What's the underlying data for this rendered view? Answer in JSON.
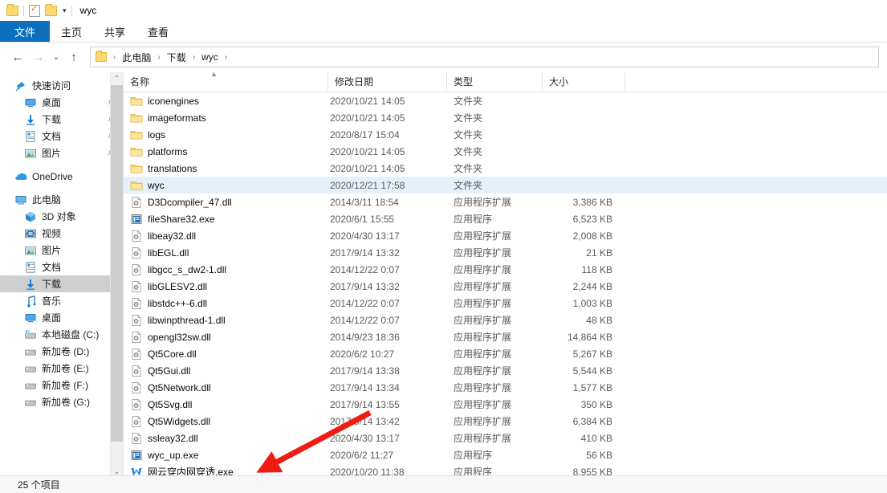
{
  "window": {
    "title": "wyc",
    "quick_access": [
      {
        "name": "folder-icon",
        "label": "文件夹"
      },
      {
        "name": "properties-icon",
        "label": "属性"
      },
      {
        "name": "new-folder-icon",
        "label": "新建文件夹"
      }
    ],
    "customize_caret": "▾"
  },
  "ribbon": {
    "tabs": [
      {
        "label": "文件",
        "active": true
      },
      {
        "label": "主页",
        "active": false
      },
      {
        "label": "共享",
        "active": false
      },
      {
        "label": "查看",
        "active": false
      }
    ],
    "file_tab_color": "#0b6fbd"
  },
  "address": {
    "back": "←",
    "forward": "→",
    "recent": "⌄",
    "up": "↑",
    "breadcrumbs": [
      "此电脑",
      "下载",
      "wyc"
    ],
    "separator": "›"
  },
  "sidebar": {
    "groups": [
      {
        "header": {
          "label": "快速访问",
          "icon": "pin-icon"
        },
        "items": [
          {
            "label": "桌面",
            "icon": "desktop-icon",
            "pinned": true
          },
          {
            "label": "下载",
            "icon": "download-icon",
            "pinned": true
          },
          {
            "label": "文档",
            "icon": "documents-icon",
            "pinned": true
          },
          {
            "label": "图片",
            "icon": "pictures-icon",
            "pinned": true
          }
        ]
      },
      {
        "header": {
          "label": "OneDrive",
          "icon": "onedrive-icon"
        },
        "items": []
      },
      {
        "header": {
          "label": "此电脑",
          "icon": "computer-icon"
        },
        "items": [
          {
            "label": "3D 对象",
            "icon": "3d-objects-icon",
            "pinned": false
          },
          {
            "label": "视频",
            "icon": "videos-icon",
            "pinned": false
          },
          {
            "label": "图片",
            "icon": "pictures-icon",
            "pinned": false
          },
          {
            "label": "文档",
            "icon": "documents-icon",
            "pinned": false
          },
          {
            "label": "下载",
            "icon": "download-icon",
            "pinned": false,
            "selected": true
          },
          {
            "label": "音乐",
            "icon": "music-icon",
            "pinned": false
          },
          {
            "label": "桌面",
            "icon": "desktop-icon",
            "pinned": false
          },
          {
            "label": "本地磁盘 (C:)",
            "icon": "system-drive-icon",
            "pinned": false
          },
          {
            "label": "新加卷 (D:)",
            "icon": "drive-icon",
            "pinned": false
          },
          {
            "label": "新加卷 (E:)",
            "icon": "drive-icon",
            "pinned": false
          },
          {
            "label": "新加卷 (F:)",
            "icon": "drive-icon",
            "pinned": false
          },
          {
            "label": "新加卷 (G:)",
            "icon": "drive-icon",
            "pinned": false
          }
        ]
      }
    ],
    "scroll_up": "⌃",
    "scroll_down": "⌄"
  },
  "filelist": {
    "columns": [
      "名称",
      "修改日期",
      "类型",
      "大小"
    ],
    "sort_indicator": "▲",
    "rows": [
      {
        "name": "iconengines",
        "date": "2020/10/21 14:05",
        "type": "文件夹",
        "size": "",
        "icon": "folder-icon",
        "selected": false
      },
      {
        "name": "imageformats",
        "date": "2020/10/21 14:05",
        "type": "文件夹",
        "size": "",
        "icon": "folder-icon",
        "selected": false
      },
      {
        "name": "logs",
        "date": "2020/8/17 15:04",
        "type": "文件夹",
        "size": "",
        "icon": "folder-icon",
        "selected": false
      },
      {
        "name": "platforms",
        "date": "2020/10/21 14:05",
        "type": "文件夹",
        "size": "",
        "icon": "folder-icon",
        "selected": false
      },
      {
        "name": "translations",
        "date": "2020/10/21 14:05",
        "type": "文件夹",
        "size": "",
        "icon": "folder-icon",
        "selected": false
      },
      {
        "name": "wyc",
        "date": "2020/12/21 17:58",
        "type": "文件夹",
        "size": "",
        "icon": "folder-icon",
        "selected": true
      },
      {
        "name": "D3Dcompiler_47.dll",
        "date": "2014/3/11 18:54",
        "type": "应用程序扩展",
        "size": "3,386 KB",
        "icon": "dll-icon",
        "selected": false
      },
      {
        "name": "fileShare32.exe",
        "date": "2020/6/1 15:55",
        "type": "应用程序",
        "size": "6,523 KB",
        "icon": "exe-icon",
        "selected": false
      },
      {
        "name": "libeay32.dll",
        "date": "2020/4/30 13:17",
        "type": "应用程序扩展",
        "size": "2,008 KB",
        "icon": "dll-icon",
        "selected": false
      },
      {
        "name": "libEGL.dll",
        "date": "2017/9/14 13:32",
        "type": "应用程序扩展",
        "size": "21 KB",
        "icon": "dll-icon",
        "selected": false
      },
      {
        "name": "libgcc_s_dw2-1.dll",
        "date": "2014/12/22 0:07",
        "type": "应用程序扩展",
        "size": "118 KB",
        "icon": "dll-icon",
        "selected": false
      },
      {
        "name": "libGLESV2.dll",
        "date": "2017/9/14 13:32",
        "type": "应用程序扩展",
        "size": "2,244 KB",
        "icon": "dll-icon",
        "selected": false
      },
      {
        "name": "libstdc++-6.dll",
        "date": "2014/12/22 0:07",
        "type": "应用程序扩展",
        "size": "1,003 KB",
        "icon": "dll-icon",
        "selected": false
      },
      {
        "name": "libwinpthread-1.dll",
        "date": "2014/12/22 0:07",
        "type": "应用程序扩展",
        "size": "48 KB",
        "icon": "dll-icon",
        "selected": false
      },
      {
        "name": "opengl32sw.dll",
        "date": "2014/9/23 18:36",
        "type": "应用程序扩展",
        "size": "14,864 KB",
        "icon": "dll-icon",
        "selected": false
      },
      {
        "name": "Qt5Core.dll",
        "date": "2020/6/2 10:27",
        "type": "应用程序扩展",
        "size": "5,267 KB",
        "icon": "dll-icon",
        "selected": false
      },
      {
        "name": "Qt5Gui.dll",
        "date": "2017/9/14 13:38",
        "type": "应用程序扩展",
        "size": "5,544 KB",
        "icon": "dll-icon",
        "selected": false
      },
      {
        "name": "Qt5Network.dll",
        "date": "2017/9/14 13:34",
        "type": "应用程序扩展",
        "size": "1,577 KB",
        "icon": "dll-icon",
        "selected": false
      },
      {
        "name": "Qt5Svg.dll",
        "date": "2017/9/14 13:55",
        "type": "应用程序扩展",
        "size": "350 KB",
        "icon": "dll-icon",
        "selected": false
      },
      {
        "name": "Qt5Widgets.dll",
        "date": "2017/9/14 13:42",
        "type": "应用程序扩展",
        "size": "6,384 KB",
        "icon": "dll-icon",
        "selected": false
      },
      {
        "name": "ssleay32.dll",
        "date": "2020/4/30 13:17",
        "type": "应用程序扩展",
        "size": "410 KB",
        "icon": "dll-icon",
        "selected": false
      },
      {
        "name": "wyc_up.exe",
        "date": "2020/6/2 11:27",
        "type": "应用程序",
        "size": "56 KB",
        "icon": "exe-icon",
        "selected": false
      },
      {
        "name": "网云穿内网穿透.exe",
        "date": "2020/10/20 11:38",
        "type": "应用程序",
        "size": "8,955 KB",
        "icon": "wyc-app-icon",
        "selected": false
      }
    ]
  },
  "statusbar": {
    "item_count": "25 个项目"
  },
  "annotation": {
    "arrow_color": "#ee1c12"
  }
}
